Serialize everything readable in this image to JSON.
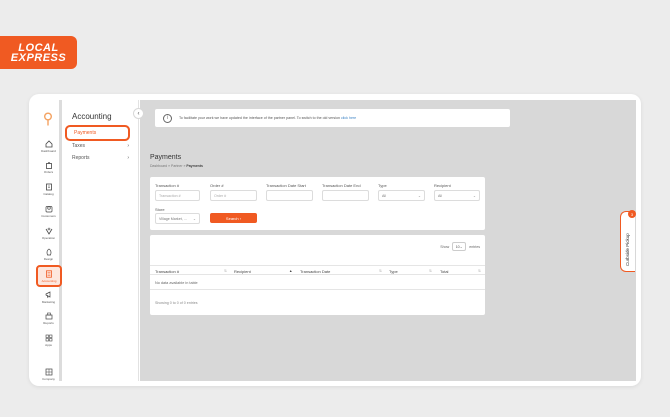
{
  "brand": {
    "logo_line1": "LOCAL",
    "logo_line2": "EXPRESS",
    "accent": "#f05a22"
  },
  "rail": {
    "items": [
      {
        "icon": "home-icon",
        "label": "Dashboard"
      },
      {
        "icon": "bag-icon",
        "label": "Orders"
      },
      {
        "icon": "catalog-icon",
        "label": "Catalog"
      },
      {
        "icon": "customers-icon",
        "label": "Customers"
      },
      {
        "icon": "operation-icon",
        "label": "Operation"
      },
      {
        "icon": "design-icon",
        "label": "Design"
      },
      {
        "icon": "accounting-icon",
        "label": "Accounting"
      },
      {
        "icon": "marketing-icon",
        "label": "Marketing"
      },
      {
        "icon": "reports-icon",
        "label": "Reports"
      },
      {
        "icon": "apps-icon",
        "label": "Apps"
      },
      {
        "icon": "company-icon",
        "label": "Company"
      }
    ]
  },
  "subpanel": {
    "title": "Accounting",
    "items": [
      {
        "label": "Payments",
        "chevron": ""
      },
      {
        "label": "Taxes",
        "chevron": "›"
      },
      {
        "label": "Reports",
        "chevron": "›"
      }
    ]
  },
  "banner": {
    "text": "To facilitate your work we have updated the interface of the partner panel. To switch to the old version",
    "link": "click here"
  },
  "page": {
    "title": "Payments",
    "breadcrumb_prefix": "Dashboard » Partner » ",
    "breadcrumb_current": "Payments"
  },
  "filters": {
    "transaction_label": "Transaction #",
    "transaction_placeholder": "Transaction #",
    "order_label": "Order #",
    "order_placeholder": "Order #",
    "start_label": "Transaction Date Start",
    "end_label": "Transaction Date End",
    "type_label": "Type",
    "type_value": "All",
    "recipient_label": "Recipient",
    "recipient_value": "All",
    "store_label": "Store",
    "store_value": "Village Market, ...",
    "search_label": "Search"
  },
  "table": {
    "show_label": "Show",
    "entries_value": "10",
    "entries_label": "entries",
    "columns": [
      "Transaction #",
      "Recipient",
      "Transaction Date",
      "Type",
      "Total"
    ],
    "empty_text": "No data available in table",
    "footer": "Showing 0 to 0 of 0 entries"
  },
  "curbside": {
    "label": "Curbside Pickup",
    "badge": "3"
  }
}
